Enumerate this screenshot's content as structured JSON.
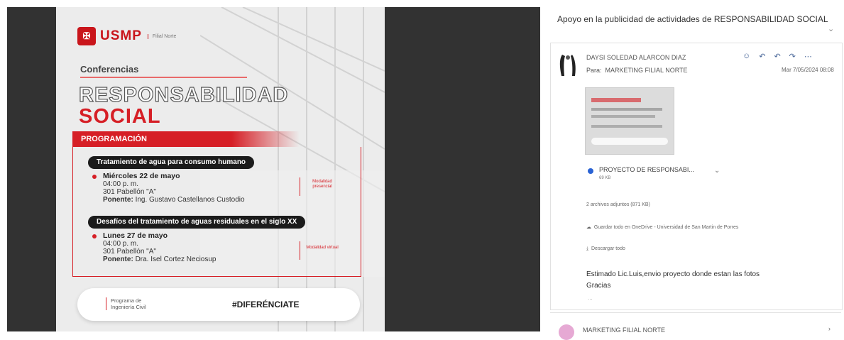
{
  "poster": {
    "logo_text": "USMP",
    "logo_sub": "Filial Norte",
    "conferencias": "Conferencias",
    "title_line1": "RESPONSABILIDAD",
    "title_line2": "SOCIAL",
    "programacion": "PROGRAMACIÓN",
    "talk1": {
      "title": "Tratamiento de agua para consumo humano",
      "day": "Miércoles 22 de mayo",
      "time": "04:00 p. m.",
      "room": "301 Pabellón \"A\"",
      "ponente_label": "Ponente:",
      "ponente": "Ing. Gustavo Castellanos Custodio",
      "tag": "Modalidad presencial"
    },
    "talk2": {
      "title": "Desafíos del tratamiento de aguas residuales en el siglo XX",
      "day": "Lunes 27 de mayo",
      "time": "04:00 p. m.",
      "room": "301 Pabellón \"A\"",
      "ponente_label": "Ponente:",
      "ponente": "Dra. Isel Cortez Neciosup",
      "tag": "Modalidad virtual"
    },
    "footer_left": "Programa de Ingeniería Civil",
    "hashtag": "#DIFERÉNCIATE"
  },
  "email": {
    "subject": "Apoyo en la publicidad de actividades de RESPONSABILIDAD SOCIAL",
    "sender": "DAYSI SOLEDAD ALARCON DIAZ",
    "to_label": "Para:",
    "to": "MARKETING FILIAL NORTE",
    "datetime": "Mar 7/05/2024 08:08",
    "attachment_name": "PROYECTO DE RESPONSABI...",
    "attachment_size": "69 KB",
    "attachments_count": "2 archivos adjuntos (871 KB)",
    "save_onedrive": "Guardar todo en OneDrive - Universidad de San Martin de Porres",
    "download_all": "Descargar todo",
    "body_line1": "Estimado Lic.Luis,envio proyecto donde estan las fotos",
    "body_line2": "Gracias",
    "ellipsis": "...",
    "second_sender": "MARKETING FILIAL NORTE"
  },
  "colors": {
    "accent_red": "#d61f26",
    "viewer_bg": "#323232",
    "link_blue": "#4d6a9b"
  },
  "icons": [
    "reaction-icon",
    "reply-icon",
    "reply-all-icon",
    "forward-icon",
    "more-icon",
    "onedrive-icon",
    "download-icon",
    "chevron-down-icon"
  ]
}
